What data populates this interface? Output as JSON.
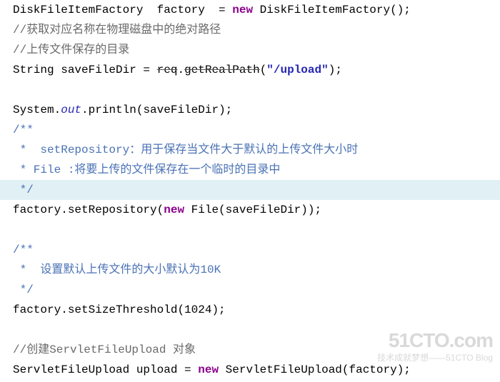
{
  "code": {
    "l1_pre": "DiskFileItemFactory  factory  = ",
    "l1_kw": "new",
    "l1_post": " DiskFileItemFactory();",
    "l2": "//获取对应名称在物理磁盘中的绝对路径",
    "l3": "//上传文件保存的目录",
    "l4_pre": "String saveFileDir = ",
    "l4_req": "req",
    "l4_dot": ".",
    "l4_method": "getRealPath",
    "l4_paren_open": "(",
    "l4_str": "\"/upload\"",
    "l4_paren_close": ");",
    "l5": "",
    "l6_pre": "System.",
    "l6_out": "out",
    "l6_post": ".println(saveFileDir);",
    "l7": "/**",
    "l8": " *  setRepository：用于保存当文件大于默认的上传文件大小时",
    "l9": " * File :将要上传的文件保存在一个临时的目录中",
    "l10": " */",
    "l11_pre": "factory.setRepository(",
    "l11_kw": "new",
    "l11_post": " File(saveFileDir));",
    "l12": "",
    "l13": "/**",
    "l14": " *  设置默认上传文件的大小默认为10K",
    "l15": " */",
    "l16": "factory.setSizeThreshold(1024);",
    "l17": "",
    "l18": "//创建ServletFileUpload 对象",
    "l19_pre": "ServletFileUpload upload = ",
    "l19_kw": "new",
    "l19_post": " ServletFileUpload(factory);"
  },
  "watermark": {
    "main": "51CTO.com",
    "sub": "技术成就梦想——51CTO Blog"
  }
}
